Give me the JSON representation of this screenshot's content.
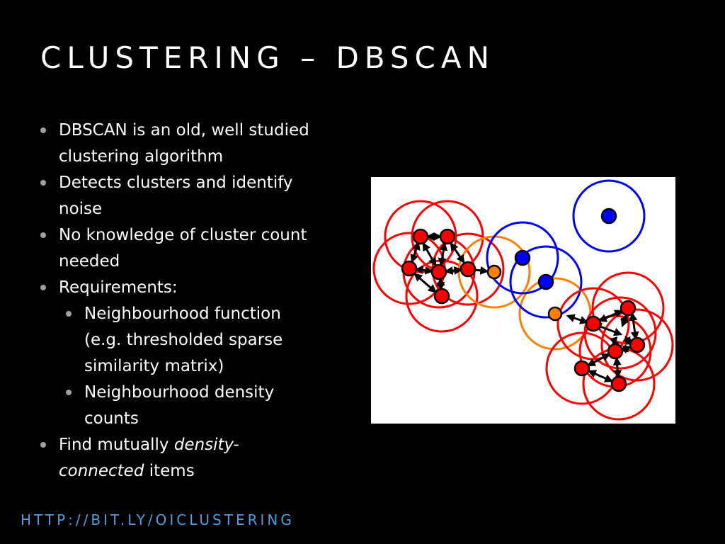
{
  "slide": {
    "title": "CLUSTERING – DBSCAN",
    "footer_link": "HTTP://BIT.LY/OICLUSTERING",
    "colors": {
      "core": "#ff0000",
      "border": "#ff8000",
      "noise": "#0000ff",
      "link": "#4a9fe0"
    },
    "bullets": [
      {
        "lines": [
          "DBSCAN is an old, well studied",
          "clustering algorithm"
        ]
      },
      {
        "lines": [
          "Detects clusters and identify",
          "noise"
        ]
      },
      {
        "lines": [
          "No knowledge of cluster count",
          "needed"
        ]
      },
      {
        "lines": [
          "Requirements:"
        ]
      }
    ],
    "sub_bullets": [
      {
        "lines": [
          "Neighbourhood function",
          "(e.g. thresholded sparse",
          "similarity matrix)"
        ]
      },
      {
        "lines": [
          "Neighbourhood density",
          "counts"
        ]
      }
    ],
    "last_bullet": {
      "prefix": "Find mutually ",
      "italic1": "density-",
      "italic2": "connected",
      "suffix": " items"
    },
    "figure": {
      "icon": "dbscan-cluster-diagram"
    }
  }
}
